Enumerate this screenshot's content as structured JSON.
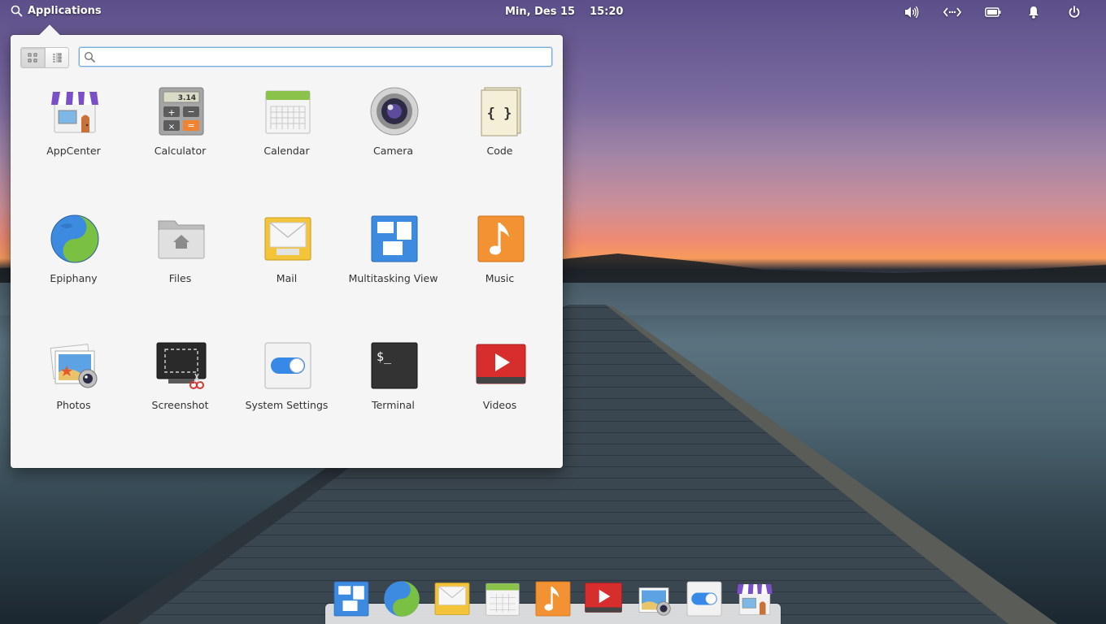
{
  "panel": {
    "applications_label": "Applications",
    "date": "Min, Des 15",
    "time": "15:20",
    "indicators": [
      "volume-icon",
      "network-icon",
      "battery-icon",
      "notifications-icon",
      "power-icon"
    ]
  },
  "launcher": {
    "search": {
      "value": "",
      "placeholder": ""
    },
    "view_modes": [
      "grid-view-icon",
      "category-view-icon"
    ],
    "apps": [
      {
        "label": "AppCenter",
        "icon": "appcenter-icon"
      },
      {
        "label": "Calculator",
        "icon": "calculator-icon"
      },
      {
        "label": "Calendar",
        "icon": "calendar-icon"
      },
      {
        "label": "Camera",
        "icon": "camera-icon"
      },
      {
        "label": "Code",
        "icon": "code-icon"
      },
      {
        "label": "Epiphany",
        "icon": "epiphany-icon"
      },
      {
        "label": "Files",
        "icon": "files-icon"
      },
      {
        "label": "Mail",
        "icon": "mail-icon"
      },
      {
        "label": "Multitasking View",
        "icon": "multitasking-icon"
      },
      {
        "label": "Music",
        "icon": "music-icon"
      },
      {
        "label": "Photos",
        "icon": "photos-icon"
      },
      {
        "label": "Screenshot",
        "icon": "screenshot-icon"
      },
      {
        "label": "System Settings",
        "icon": "settings-icon"
      },
      {
        "label": "Terminal",
        "icon": "terminal-icon"
      },
      {
        "label": "Videos",
        "icon": "videos-icon"
      }
    ],
    "calculator_display": "3.14",
    "terminal_prompt": "$_"
  },
  "dock": {
    "items": [
      "multitasking-icon",
      "epiphany-icon",
      "mail-icon",
      "calendar-icon",
      "music-icon",
      "videos-icon",
      "photos-icon",
      "settings-icon",
      "appcenter-icon"
    ]
  },
  "colors": {
    "accent": "#3689e6",
    "search_border": "#7aaee0"
  }
}
